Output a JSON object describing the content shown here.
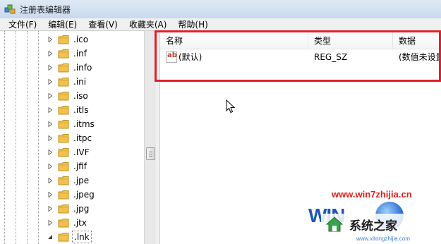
{
  "window": {
    "title": "注册表编辑器"
  },
  "menu": [
    "文件(F)",
    "编辑(E)",
    "查看(V)",
    "收藏夹(A)",
    "帮助(H)"
  ],
  "tree": {
    "items": [
      {
        "label": ".ico"
      },
      {
        "label": ".inf"
      },
      {
        "label": ".info"
      },
      {
        "label": ".ini"
      },
      {
        "label": ".iso"
      },
      {
        "label": ".itls"
      },
      {
        "label": ".itms"
      },
      {
        "label": ".itpc"
      },
      {
        "label": ".IVF"
      },
      {
        "label": ".jfif"
      },
      {
        "label": ".jpe"
      },
      {
        "label": ".jpeg"
      },
      {
        "label": ".jpg"
      },
      {
        "label": ".jtx"
      },
      {
        "label": ".lnk"
      }
    ],
    "selected": ".lnk"
  },
  "list": {
    "columns": [
      "名称",
      "类型",
      "数据"
    ],
    "rows": [
      {
        "name": "(默认)",
        "type": "REG_SZ",
        "data": "(数值未设置"
      }
    ]
  },
  "icons": {
    "app": "regedit-icon",
    "folder": "folder-icon",
    "expander": "expand-arrow-icon",
    "value": "string-value-icon",
    "cursor": "mouse-pointer-icon"
  },
  "colors": {
    "highlight_border": "#e0202a",
    "folder": "#f2c14e",
    "watermark": "#e02020"
  },
  "watermark": {
    "url": "www.win7zhijia.cn",
    "logo": "WIN",
    "brand": "系统之家",
    "domain": "www.xitongzhijia.com"
  }
}
